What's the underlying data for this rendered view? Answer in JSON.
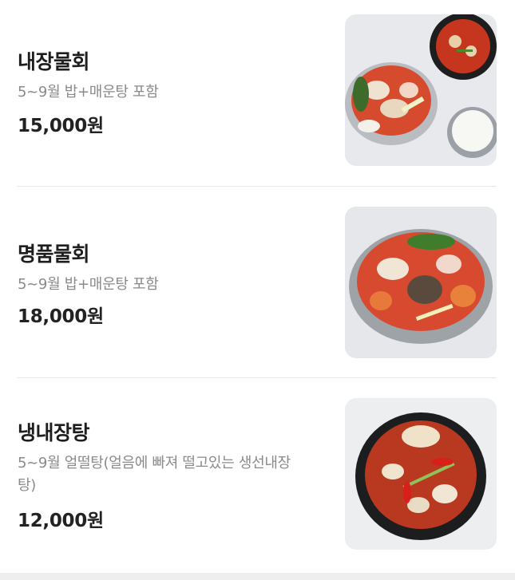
{
  "menu": {
    "items": [
      {
        "name": "내장물회",
        "description": "5~9월 밥+매운탕 포함",
        "price": "15,000원"
      },
      {
        "name": "명품물회",
        "description": "5~9월 밥+매운탕 포함",
        "price": "18,000원"
      },
      {
        "name": "냉내장탕",
        "description": "5~9월 얼떨탕(얼음에 빠져 떨고있는 생선내장\n탕)",
        "price": "12,000원"
      }
    ]
  }
}
